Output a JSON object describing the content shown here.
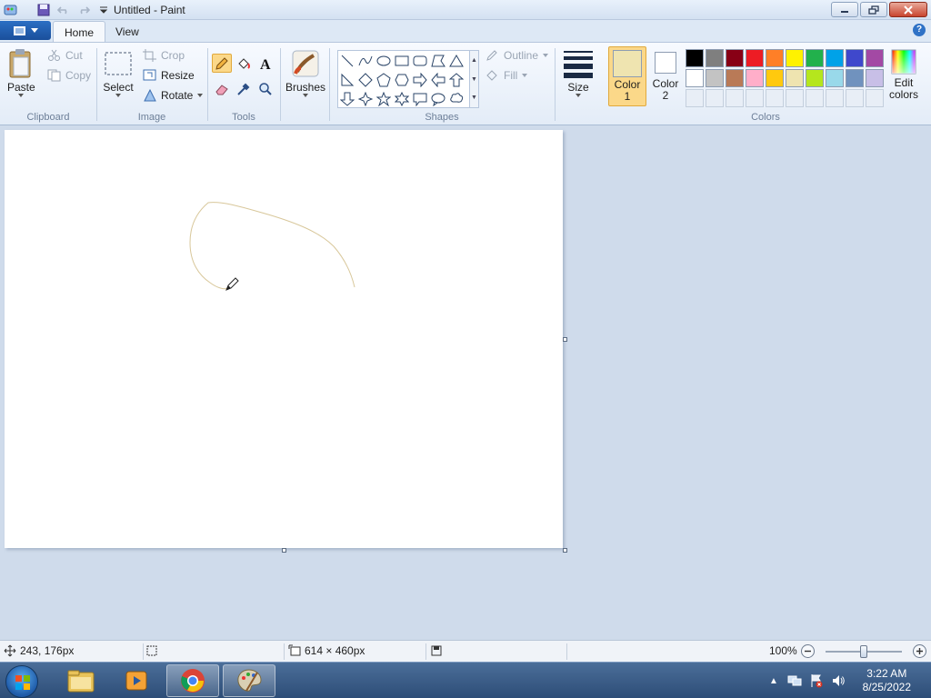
{
  "window": {
    "title": "Untitled - Paint"
  },
  "tabs": [
    {
      "label": "Home"
    },
    {
      "label": "View"
    }
  ],
  "clipboard": {
    "paste": "Paste",
    "cut": "Cut",
    "copy": "Copy",
    "group": "Clipboard"
  },
  "image": {
    "select": "Select",
    "crop": "Crop",
    "resize": "Resize",
    "rotate": "Rotate",
    "group": "Image"
  },
  "tools": {
    "group": "Tools"
  },
  "brushes": {
    "label": "Brushes"
  },
  "shapes": {
    "outline": "Outline",
    "fill": "Fill",
    "group": "Shapes"
  },
  "size": {
    "label": "Size"
  },
  "colors": {
    "color1_label": "Color 1",
    "color2_label": "Color 2",
    "edit_label": "Edit colors",
    "group": "Colors",
    "color1_value": "#efe4b0",
    "color2_value": "#ffffff",
    "row1": [
      "#000000",
      "#7f7f7f",
      "#880015",
      "#ed1c24",
      "#ff7f27",
      "#fff200",
      "#22b14c",
      "#00a2e8",
      "#3f48cc",
      "#a349a4"
    ],
    "row2": [
      "#ffffff",
      "#c3c3c3",
      "#b97a57",
      "#ffaec9",
      "#ffc90e",
      "#efe4b0",
      "#b5e61d",
      "#99d9ea",
      "#7092be",
      "#c8bfe7"
    ]
  },
  "status": {
    "cursor_pos": "243, 176px",
    "canvas_size": "614 × 460px",
    "zoom": "100%",
    "zoom_fraction": 0.5
  },
  "clock": {
    "time": "3:22 AM",
    "date": "8/25/2022"
  },
  "stroke_color": "#d8c79a"
}
